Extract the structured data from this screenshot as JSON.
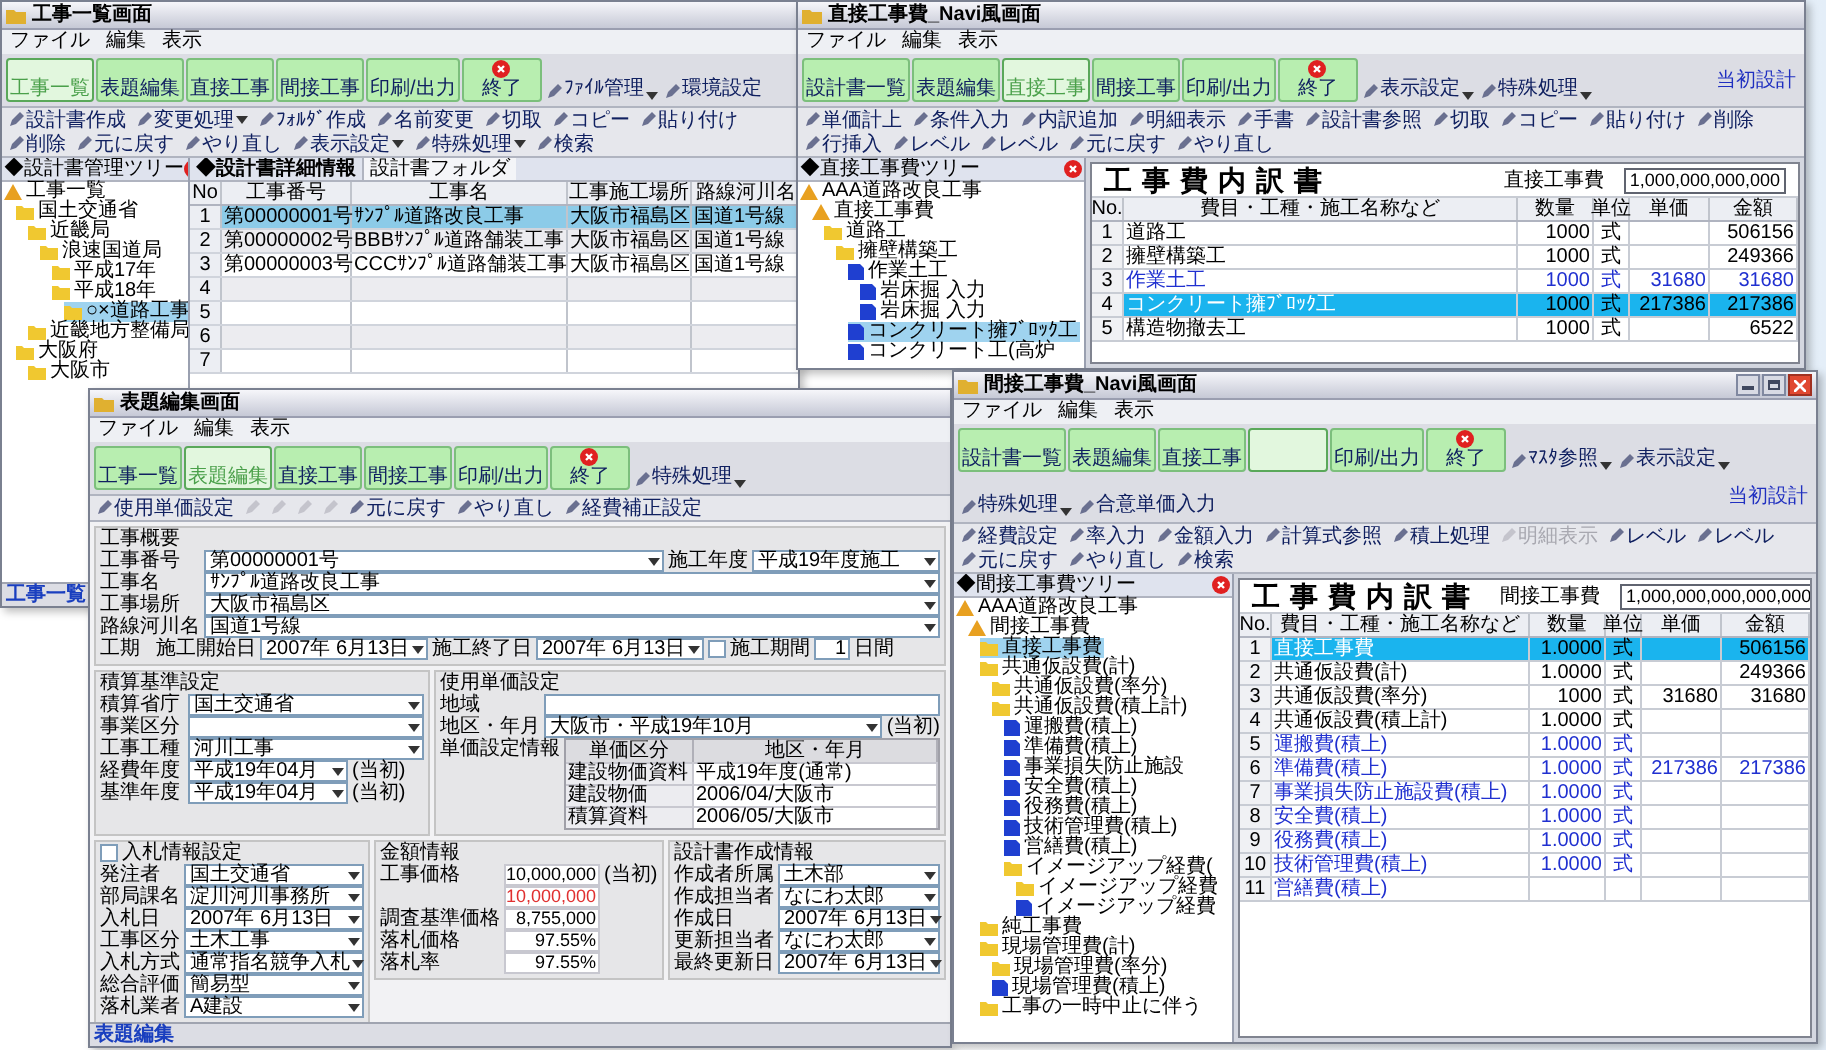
{
  "windows": [
    {
      "kind": "list",
      "title": "工事一覧画面",
      "menu": [
        "ファイル",
        "編集",
        "表示"
      ],
      "buttons": [
        {
          "kind": "big",
          "label": "工事一覧",
          "selected": true
        },
        {
          "kind": "big",
          "label": "表題編集",
          "selected": false
        },
        {
          "kind": "big",
          "label": "直接工事",
          "selected": false
        },
        {
          "kind": "big",
          "label": "間接工事",
          "selected": false
        },
        {
          "kind": "big",
          "label": "印刷/出力",
          "selected": false
        },
        {
          "kind": "exit",
          "label": "終了",
          "selected": false
        },
        {
          "kind": "menu",
          "label": "ﾌｧｲﾙ管理"
        },
        {
          "kind": "plain",
          "label": "環境設定"
        }
      ],
      "toolbar": [
        {
          "label": "設計書作成",
          "disabled": false
        },
        {
          "label": "変更処理",
          "dropdown": true,
          "disabled": false
        },
        {
          "label": "ﾌｫﾙﾀﾞ作成",
          "disabled": false
        },
        {
          "label": "名前変更",
          "disabled": false
        },
        {
          "label": "切取",
          "disabled": false
        },
        {
          "label": "コピー",
          "disabled": false
        },
        {
          "label": "貼り付け",
          "disabled": false
        },
        {
          "label": "削除",
          "disabled": false
        },
        {
          "label": "元に戻す",
          "disabled": false
        },
        {
          "label": "やり直し",
          "disabled": false
        },
        {
          "label": "表示設定",
          "dropdown": true,
          "disabled": false
        },
        {
          "label": "特殊処理",
          "dropdown": true,
          "disabled": false
        },
        {
          "label": "検索",
          "disabled": false
        }
      ],
      "tree_title": "◆設計書管理ツリー",
      "tree": [
        {
          "kind": "project",
          "label": "工事一覧",
          "selected": false,
          "children": [
            {
              "kind": "folder",
              "label": "国土交通省",
              "selected": false,
              "children": [
                {
                  "kind": "folder",
                  "label": "近畿局",
                  "selected": false,
                  "children": [
                    {
                      "kind": "folder",
                      "label": "浪速国道局",
                      "selected": false,
                      "children": [
                        {
                          "kind": "folder",
                          "label": "平成17年",
                          "selected": false
                        },
                        {
                          "kind": "folder",
                          "label": "平成18年",
                          "selected": false,
                          "children": [
                            {
                              "kind": "folder",
                              "label": "○×道路工事",
                              "selected": true
                            }
                          ]
                        }
                      ]
                    }
                  ]
                },
                {
                  "kind": "folder",
                  "label": "近畿地方整備局",
                  "selected": false
                }
              ]
            },
            {
              "kind": "folder",
              "label": "大阪府",
              "selected": false,
              "children": [
                {
                  "kind": "folder",
                  "label": "大阪市",
                  "selected": false
                }
              ]
            }
          ]
        }
      ],
      "tabs": [
        {
          "label": "◆設計書詳細情報",
          "selected": true
        },
        {
          "label": "設計書フォルダ",
          "selected": false
        }
      ],
      "table": {
        "columns": [
          "No",
          "工事番号",
          "工事名",
          "工事施工場所",
          "路線河川名"
        ],
        "rows": [
          {
            "no": "1",
            "cells": [
              "第00000001号",
              "ｻﾝﾌﾟﾙ道路改良工事",
              "大阪市福島区",
              "国道1号線"
            ],
            "selected": true
          },
          {
            "no": "2",
            "cells": [
              "第00000002号",
              "BBBｻﾝﾌﾟﾙ道路舗装工事",
              "大阪市福島区",
              "国道1号線"
            ],
            "selected": false
          },
          {
            "no": "3",
            "cells": [
              "第00000003号",
              "CCCｻﾝﾌﾟﾙ道路舗装工事",
              "大阪市福島区",
              "国道1号線"
            ],
            "selected": false
          },
          {
            "no": "4",
            "selected": false
          },
          {
            "no": "5",
            "selected": false
          },
          {
            "no": "6",
            "selected": false
          },
          {
            "no": "7",
            "selected": false
          }
        ]
      },
      "status": "工事一覧"
    },
    {
      "kind": "breakdown",
      "title": "直接工事費_Navi風画面",
      "menu": [
        "ファイル",
        "編集",
        "表示"
      ],
      "buttons": [
        {
          "kind": "big",
          "label": "設計書一覧",
          "selected": false
        },
        {
          "kind": "big",
          "label": "表題編集",
          "selected": false
        },
        {
          "kind": "big",
          "label": "直接工事",
          "selected": true
        },
        {
          "kind": "big",
          "label": "間接工事",
          "selected": false
        },
        {
          "kind": "big",
          "label": "印刷/出力",
          "selected": false
        },
        {
          "kind": "exit",
          "label": "終了",
          "selected": false
        },
        {
          "kind": "menu",
          "label": "表示設定"
        },
        {
          "kind": "menu",
          "label": "特殊処理"
        },
        {
          "kind": "mode",
          "label": "当初設計"
        }
      ],
      "toolbar": [
        {
          "label": "単価計上",
          "disabled": false
        },
        {
          "label": "条件入力",
          "disabled": false
        },
        {
          "label": "内訳追加",
          "disabled": false
        },
        {
          "label": "明細表示",
          "disabled": false
        },
        {
          "label": "手書",
          "disabled": false
        },
        {
          "label": "設計書参照",
          "disabled": false
        },
        {
          "label": "切取",
          "disabled": false
        },
        {
          "label": "コピー",
          "disabled": false
        },
        {
          "label": "貼り付け",
          "disabled": false
        },
        {
          "label": "削除",
          "disabled": false
        },
        {
          "label": "行挿入",
          "disabled": false
        },
        {
          "label": "レベル",
          "disabled": false
        },
        {
          "label": "レベル",
          "disabled": false
        },
        {
          "label": "元に戻す",
          "disabled": false
        },
        {
          "label": "やり直し",
          "disabled": false
        }
      ],
      "tree_title": "◆直接工事費ツリー",
      "tree": [
        {
          "kind": "project",
          "label": "AAA道路改良工事",
          "selected": false,
          "children": [
            {
              "kind": "project",
              "label": "直接工事費",
              "selected": false,
              "children": [
                {
                  "kind": "folder",
                  "label": "道路工",
                  "selected": false,
                  "children": [
                    {
                      "kind": "folder",
                      "label": "擁壁構築工",
                      "selected": false,
                      "children": [
                        {
                          "kind": "doc",
                          "label": "作業土工",
                          "selected": false,
                          "children": [
                            {
                              "kind": "doc",
                              "label": "岩床掘 入力",
                              "selected": false
                            },
                            {
                              "kind": "doc",
                              "label": "岩床掘 入力",
                              "selected": false
                            }
                          ]
                        },
                        {
                          "kind": "doc",
                          "label": "コンクリート擁ﾌﾞﾛｯｸ工",
                          "selected": true
                        },
                        {
                          "kind": "doc",
                          "label": "コンクリート工(高炉",
                          "selected": false
                        }
                      ]
                    }
                  ]
                }
              ]
            }
          ]
        }
      ],
      "sheet": {
        "heading": "工事費内訳書",
        "category": "直接工事費",
        "total": "1,000,000,000,000",
        "columns": [
          "No.",
          "費目・工種・施工名称など",
          "数量",
          "単位",
          "単価",
          "金額"
        ],
        "rows": [
          {
            "no": "1",
            "name": "道路工",
            "qty": "1000",
            "unit": "式",
            "amount": "506156",
            "kind": "sum",
            "selected": false
          },
          {
            "no": "2",
            "name": "擁壁構築工",
            "qty": "1000",
            "unit": "式",
            "amount": "249366",
            "kind": "sum",
            "selected": false
          },
          {
            "no": "3",
            "name": "作業土工",
            "qty": "1000",
            "unit": "式",
            "price": "31680",
            "amount": "31680",
            "kind": "item",
            "selected": false
          },
          {
            "no": "4",
            "name": "コンクリート擁ﾌﾞﾛｯｸ工",
            "qty": "1000",
            "unit": "式",
            "price": "217386",
            "amount": "217386",
            "kind": "item",
            "selected": true
          },
          {
            "no": "5",
            "name": "構造物撤去工",
            "qty": "1000",
            "unit": "式",
            "amount": "6522",
            "kind": "sum",
            "selected": false
          }
        ]
      }
    },
    {
      "kind": "form",
      "title": "表題編集画面",
      "menu": [
        "ファイル",
        "編集",
        "表示"
      ],
      "buttons": [
        {
          "kind": "big",
          "label": "工事一覧",
          "selected": false
        },
        {
          "kind": "big",
          "label": "表題編集",
          "selected": true
        },
        {
          "kind": "big",
          "label": "直接工事",
          "selected": false
        },
        {
          "kind": "big",
          "label": "間接工事",
          "selected": false
        },
        {
          "kind": "big",
          "label": "印刷/出力",
          "selected": false
        },
        {
          "kind": "exit",
          "label": "終了",
          "selected": false
        },
        {
          "kind": "menu",
          "label": "特殊処理"
        }
      ],
      "toolbar": [
        {
          "label": "使用単価設定",
          "disabled": false
        },
        {
          "disabled": true
        },
        {
          "disabled": true
        },
        {
          "disabled": true
        },
        {
          "disabled": true
        },
        {
          "label": "元に戻す",
          "disabled": false
        },
        {
          "label": "やり直し",
          "disabled": false
        },
        {
          "label": "経費補正設定",
          "disabled": false
        }
      ],
      "form": {
        "overview": {
          "title": "工事概要",
          "number": {
            "label": "工事番号",
            "value": "第00000001号"
          },
          "year": {
            "label": "施工年度",
            "value": "平成19年度施工"
          },
          "name": {
            "label": "工事名",
            "value": "ｻﾝﾌﾟﾙ道路改良工事"
          },
          "place": {
            "label": "工事場所",
            "value": "大阪市福島区"
          },
          "route": {
            "label": "路線河川名",
            "value": "国道1号線"
          },
          "period": {
            "label": "工期",
            "start_label": "施工開始日",
            "start": "2007年 6月13日",
            "end_label": "施工終了日",
            "end": "2007年 6月13日",
            "days_label": "施工期間",
            "checked": false,
            "days": "1",
            "unit": "日間"
          }
        },
        "estimate": {
          "title": "積算基準設定",
          "fields": [
            {
              "label": "積算省庁",
              "value": "国土交通省"
            },
            {
              "label": "事業区分"
            },
            {
              "label": "工事工種",
              "value": "河川工事"
            },
            {
              "label": "経費年度",
              "value": "平成19年04月",
              "note": "(当初)"
            },
            {
              "label": "基準年度",
              "value": "平成19年04月",
              "note": "(当初)"
            }
          ]
        },
        "unit_price": {
          "title": "使用単価設定",
          "region": {
            "label": "地域"
          },
          "area": {
            "label": "地区・年月",
            "value": "大阪市・平成19年10月",
            "note": "(当初)"
          },
          "info_label": "単価設定情報",
          "columns": [
            "単価区分",
            "地区・年月"
          ],
          "rows": [
            [
              "建設物価資料",
              "平成19年度(通常)"
            ],
            [
              "建設物価",
              "2006/04/大阪市"
            ],
            [
              "積算資料",
              "2006/05/大阪市"
            ]
          ]
        },
        "bid": {
          "title": "入札情報設定",
          "checked": false,
          "fields": [
            {
              "label": "発注者",
              "value": "国土交通省"
            },
            {
              "label": "部局課名",
              "value": "淀川河川事務所"
            },
            {
              "label": "入札日",
              "value": "2007年 6月13日"
            },
            {
              "label": "工事区分",
              "value": "土木工事"
            },
            {
              "label": "入札方式",
              "value": "通常指名競争入札"
            },
            {
              "label": "総合評価",
              "value": "簡易型"
            },
            {
              "label": "落札業者",
              "value": "A建設"
            }
          ]
        },
        "amount": {
          "title": "金額情報",
          "rows": [
            {
              "label": "工事価格",
              "value": "10,000,000",
              "note": "(当初)",
              "kind": "normal"
            },
            {
              "value": "10,000,000",
              "kind": "changed"
            },
            {
              "label": "調査基準価格",
              "value": "8,755,000",
              "kind": "normal"
            },
            {
              "label": "落札価格",
              "value": "97.55%",
              "kind": "normal"
            },
            {
              "label": "落札率",
              "value": "97.55%",
              "kind": "normal"
            }
          ]
        },
        "author": {
          "title": "設計書作成情報",
          "fields": [
            {
              "label": "作成者所属",
              "value": "土木部"
            },
            {
              "label": "作成担当者",
              "value": "なにわ太郎"
            },
            {
              "label": "作成日",
              "value": "2007年 6月13日"
            },
            {
              "label": "更新担当者",
              "value": "なにわ太郎"
            },
            {
              "label": "最終更新日",
              "value": "2007年 6月13日"
            }
          ]
        }
      },
      "status": "表題編集"
    },
    {
      "kind": "breakdown",
      "title": "間接工事費_Navi風画面",
      "window_controls": true,
      "menu": [
        "ファイル",
        "編集",
        "表示"
      ],
      "buttons": [
        {
          "kind": "big",
          "label": "設計書一覧",
          "selected": false
        },
        {
          "kind": "big",
          "label": "表題編集",
          "selected": false
        },
        {
          "kind": "big",
          "label": "直接工事",
          "selected": false
        },
        {
          "kind": "big",
          "selected": true
        },
        {
          "kind": "big",
          "label": "印刷/出力",
          "selected": false
        },
        {
          "kind": "exit",
          "label": "終了",
          "selected": false
        },
        {
          "kind": "menu",
          "label": "ﾏｽﾀ参照"
        },
        {
          "kind": "menu",
          "label": "表示設定"
        },
        {
          "kind": "menu",
          "label": "特殊処理"
        },
        {
          "kind": "plain",
          "label": "合意単価入力"
        },
        {
          "kind": "mode",
          "label": "当初設計"
        }
      ],
      "toolbar": [
        {
          "label": "経費設定",
          "disabled": false
        },
        {
          "label": "率入力",
          "disabled": false
        },
        {
          "label": "金額入力",
          "disabled": false
        },
        {
          "label": "計算式参照",
          "disabled": false
        },
        {
          "label": "積上処理",
          "disabled": false
        },
        {
          "label": "明細表示",
          "disabled": true
        },
        {
          "label": "レベル",
          "disabled": false
        },
        {
          "label": "レベル",
          "disabled": false
        },
        {
          "label": "元に戻す",
          "disabled": false
        },
        {
          "label": "やり直し",
          "disabled": false
        },
        {
          "label": "検索",
          "disabled": false
        }
      ],
      "tree_title": "◆間接工事費ツリー",
      "tree": [
        {
          "kind": "project",
          "label": "AAA道路改良工事",
          "selected": false,
          "children": [
            {
              "kind": "project",
              "label": "間接工事費",
              "selected": false,
              "children": [
                {
                  "kind": "folder",
                  "label": "直接工事費",
                  "selected": true
                },
                {
                  "kind": "folder",
                  "label": "共通仮設費(計)",
                  "selected": false,
                  "children": [
                    {
                      "kind": "folder",
                      "label": "共通仮設費(率分)",
                      "selected": false
                    },
                    {
                      "kind": "folder",
                      "label": "共通仮設費(積上計)",
                      "selected": false,
                      "children": [
                        {
                          "kind": "doc",
                          "label": "運搬費(積上)",
                          "selected": false
                        },
                        {
                          "kind": "doc",
                          "label": "準備費(積上)",
                          "selected": false
                        },
                        {
                          "kind": "doc",
                          "label": "事業損失防止施設",
                          "selected": false
                        },
                        {
                          "kind": "doc",
                          "label": "安全費(積上)",
                          "selected": false
                        },
                        {
                          "kind": "doc",
                          "label": "役務費(積上)",
                          "selected": false
                        },
                        {
                          "kind": "doc",
                          "label": "技術管理費(積上)",
                          "selected": false
                        },
                        {
                          "kind": "doc",
                          "label": "営繕費(積上)",
                          "selected": false
                        },
                        {
                          "kind": "folder",
                          "label": "イメージアップ経費(",
                          "selected": false,
                          "children": [
                            {
                              "kind": "folder",
                              "label": "イメージアップ経費",
                              "selected": false
                            },
                            {
                              "kind": "doc",
                              "label": "イメージアップ経費",
                              "selected": false
                            }
                          ]
                        }
                      ]
                    }
                  ]
                },
                {
                  "kind": "folder",
                  "label": "純工事費",
                  "selected": false
                },
                {
                  "kind": "folder",
                  "label": "現場管理費(計)",
                  "selected": false,
                  "children": [
                    {
                      "kind": "folder",
                      "label": "現場管理費(率分)",
                      "selected": false
                    },
                    {
                      "kind": "doc",
                      "label": "現場管理費(積上)",
                      "selected": false
                    }
                  ]
                },
                {
                  "kind": "folder",
                  "label": "工事の一時中止に伴う",
                  "selected": false
                }
              ]
            }
          ]
        }
      ],
      "sheet": {
        "heading": "工事費内訳書",
        "category": "間接工事費",
        "total": "1,000,000,000,000,000",
        "columns": [
          "No.",
          "費目・工種・施工名称など",
          "数量",
          "単位",
          "単価",
          "金額"
        ],
        "rows": [
          {
            "no": "1",
            "name": "直接工事費",
            "qty": "1.0000",
            "unit": "式",
            "amount": "506156",
            "kind": "sum",
            "selected": true
          },
          {
            "no": "2",
            "name": "共通仮設費(計)",
            "qty": "1.0000",
            "unit": "式",
            "amount": "249366",
            "kind": "sum",
            "selected": false
          },
          {
            "no": "3",
            "name": "共通仮設費(率分)",
            "qty": "1000",
            "unit": "式",
            "price": "31680",
            "amount": "31680",
            "kind": "sum",
            "selected": false
          },
          {
            "no": "4",
            "name": "共通仮設費(積上計)",
            "qty": "1.0000",
            "unit": "式",
            "kind": "sum",
            "selected": false
          },
          {
            "no": "5",
            "name": "運搬費(積上)",
            "qty": "1.0000",
            "unit": "式",
            "kind": "item",
            "selected": false
          },
          {
            "no": "6",
            "name": "準備費(積上)",
            "qty": "1.0000",
            "unit": "式",
            "price": "217386",
            "amount": "217386",
            "kind": "item",
            "selected": false
          },
          {
            "no": "7",
            "name": "事業損失防止施設費(積上)",
            "qty": "1.0000",
            "unit": "式",
            "kind": "item",
            "selected": false
          },
          {
            "no": "8",
            "name": "安全費(積上)",
            "qty": "1.0000",
            "unit": "式",
            "kind": "item",
            "selected": false
          },
          {
            "no": "9",
            "name": "役務費(積上)",
            "qty": "1.0000",
            "unit": "式",
            "kind": "item",
            "selected": false
          },
          {
            "no": "10",
            "name": "技術管理費(積上)",
            "qty": "1.0000",
            "unit": "式",
            "kind": "item",
            "selected": false
          },
          {
            "no": "11",
            "name": "営繕費(積上)",
            "kind": "item",
            "selected": false
          }
        ]
      }
    }
  ]
}
